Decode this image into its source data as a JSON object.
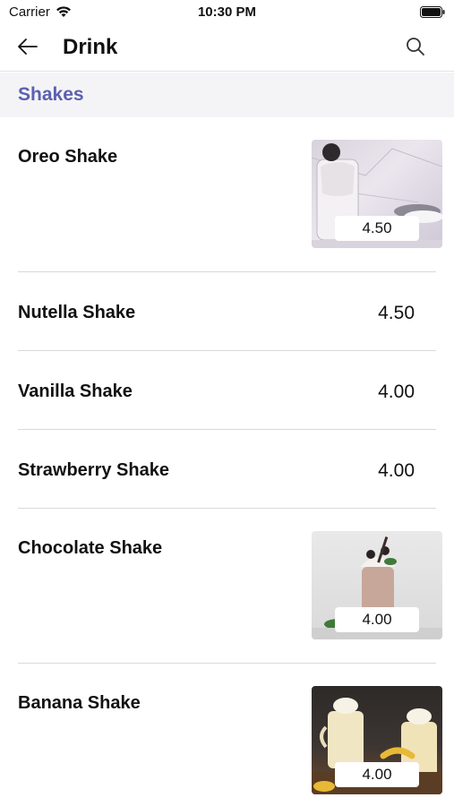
{
  "status_bar": {
    "carrier": "Carrier",
    "time": "10:30 PM"
  },
  "nav": {
    "title": "Drink",
    "back_icon": "arrow-left-icon",
    "search_icon": "search-icon"
  },
  "section": {
    "title": "Shakes",
    "color": "#5b60b0"
  },
  "items": [
    {
      "name": "Oreo Shake",
      "price": "4.50",
      "has_image": true,
      "image": "oreo-shake-photo"
    },
    {
      "name": "Nutella Shake",
      "price": "4.50",
      "has_image": false
    },
    {
      "name": "Vanilla Shake",
      "price": "4.00",
      "has_image": false
    },
    {
      "name": "Strawberry Shake",
      "price": "4.00",
      "has_image": false
    },
    {
      "name": "Chocolate Shake",
      "price": "4.00",
      "has_image": true,
      "image": "chocolate-shake-photo"
    },
    {
      "name": "Banana Shake",
      "price": "4.00",
      "has_image": true,
      "image": "banana-shake-photo"
    }
  ]
}
